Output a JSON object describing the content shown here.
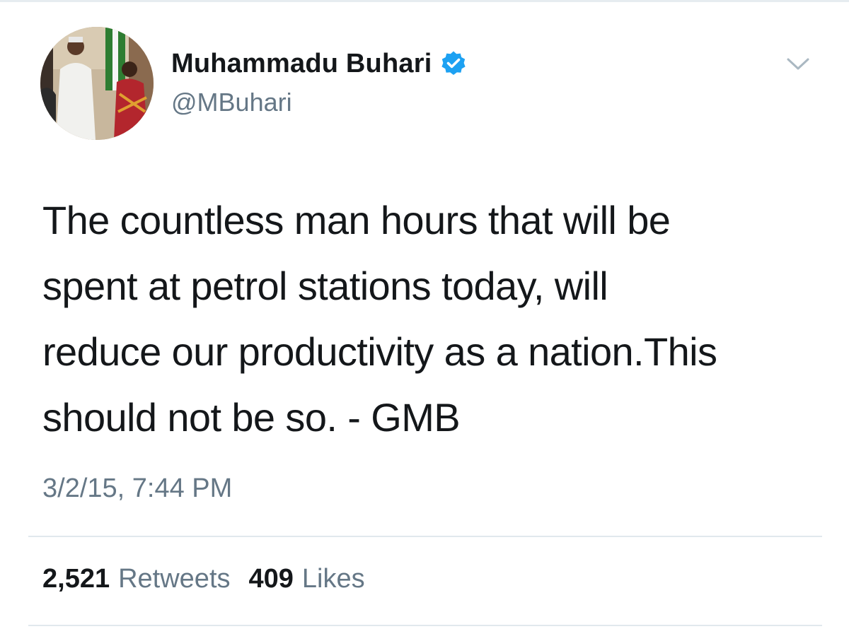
{
  "tweet": {
    "author": {
      "display_name": "Muhammadu Buhari",
      "handle": "@MBuhari",
      "verified": true,
      "avatar_icon": "profile-photo"
    },
    "menu_icon": "chevron-down-icon",
    "text": "The countless man hours that will be\nspent at petrol stations today, will\nreduce our productivity as a nation.This\nshould not be so. - GMB",
    "timestamp": "3/2/15, 7:44 PM",
    "stats": {
      "retweets_count": "2,521",
      "retweets_label": "Retweets",
      "likes_count": "409",
      "likes_label": "Likes"
    }
  },
  "colors": {
    "text": "#14171a",
    "secondary": "#657786",
    "verified": "#1da1f2",
    "divider": "#e1e8ed"
  }
}
